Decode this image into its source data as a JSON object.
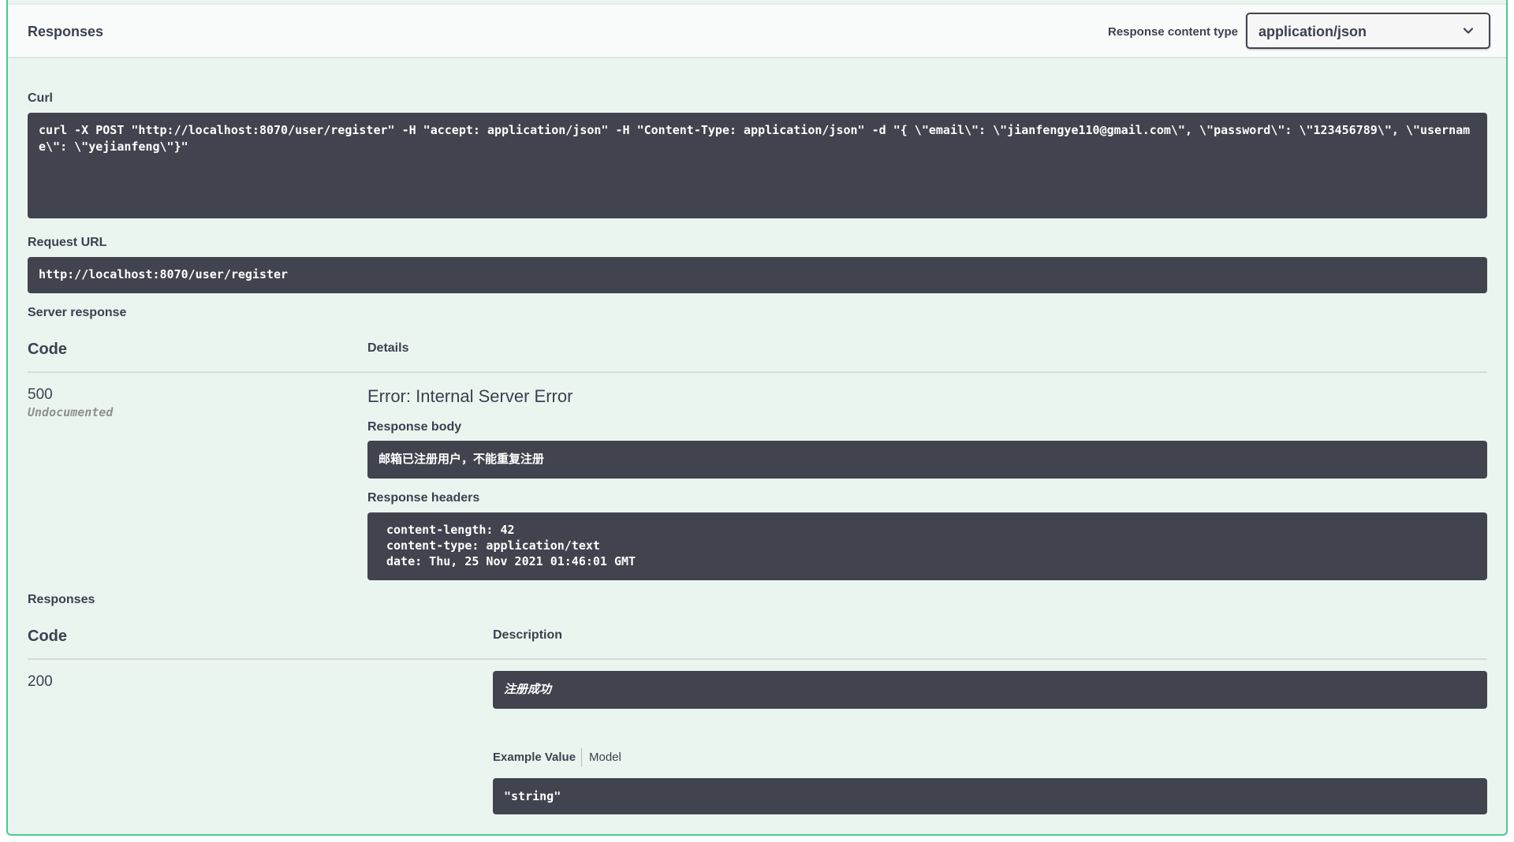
{
  "header": {
    "title": "Responses",
    "content_type_label": "Response content type",
    "content_type_value": "application/json"
  },
  "curl": {
    "label": "Curl",
    "command": "curl -X POST \"http://localhost:8070/user/register\" -H \"accept: application/json\" -H \"Content-Type: application/json\" -d \"{ \\\"email\\\": \\\"jianfengye110@gmail.com\\\", \\\"password\\\": \\\"123456789\\\", \\\"username\\\": \\\"yejianfeng\\\"}\""
  },
  "request_url": {
    "label": "Request URL",
    "value": "http://localhost:8070/user/register"
  },
  "server_response": {
    "label": "Server response",
    "code_header": "Code",
    "details_header": "Details",
    "code": "500",
    "code_note": "Undocumented",
    "error_title": "Error: Internal Server Error",
    "body_label": "Response body",
    "body": "邮箱已注册用户，不能重复注册",
    "headers_label": "Response headers",
    "headers": [
      "content-length: 42",
      "content-type: application/text",
      "date: Thu, 25 Nov 2021 01:46:01 GMT"
    ]
  },
  "responses": {
    "label": "Responses",
    "code_header": "Code",
    "description_header": "Description",
    "code": "200",
    "description": "注册成功",
    "tabs": {
      "example_value": "Example Value",
      "model": "Model"
    },
    "example": "\"string\""
  },
  "icons": {
    "chevron": "chevron-down-icon"
  },
  "colors": {
    "accent_border": "#49cc90",
    "panel_bg": "#ebf5ef",
    "code_block_bg": "#41444e"
  }
}
